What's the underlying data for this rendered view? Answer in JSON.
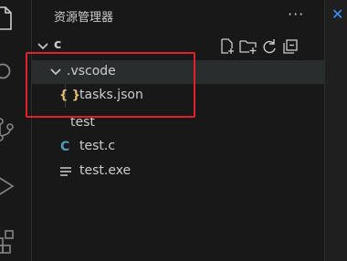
{
  "explorer": {
    "title": "资源管理器",
    "more": "···",
    "folder": {
      "name": "c"
    },
    "actions": [
      {
        "name": "new-file-icon"
      },
      {
        "name": "new-folder-icon"
      },
      {
        "name": "refresh-icon"
      },
      {
        "name": "collapse-all-icon"
      }
    ],
    "tree": {
      "vscode": {
        "label": ".vscode"
      },
      "tasks": {
        "label": "tasks.json",
        "icon_glyph": "{ }"
      },
      "test_folder": {
        "label": "test"
      },
      "test_c": {
        "label": "test.c",
        "icon_glyph": "C"
      },
      "test_exe": {
        "label": "test.exe"
      }
    }
  },
  "activity_bar": {
    "items": [
      "explorer-icon",
      "search-icon",
      "source-control-icon",
      "run-debug-icon",
      "extensions-icon"
    ]
  },
  "editor": {
    "tab_close": "✕"
  },
  "colors": {
    "background": "#181818",
    "text": "#cccccc",
    "json_icon": "#e5c07b",
    "c_icon": "#519aba",
    "highlight_box": "#e0202a",
    "tab_close": "#3794ff"
  }
}
